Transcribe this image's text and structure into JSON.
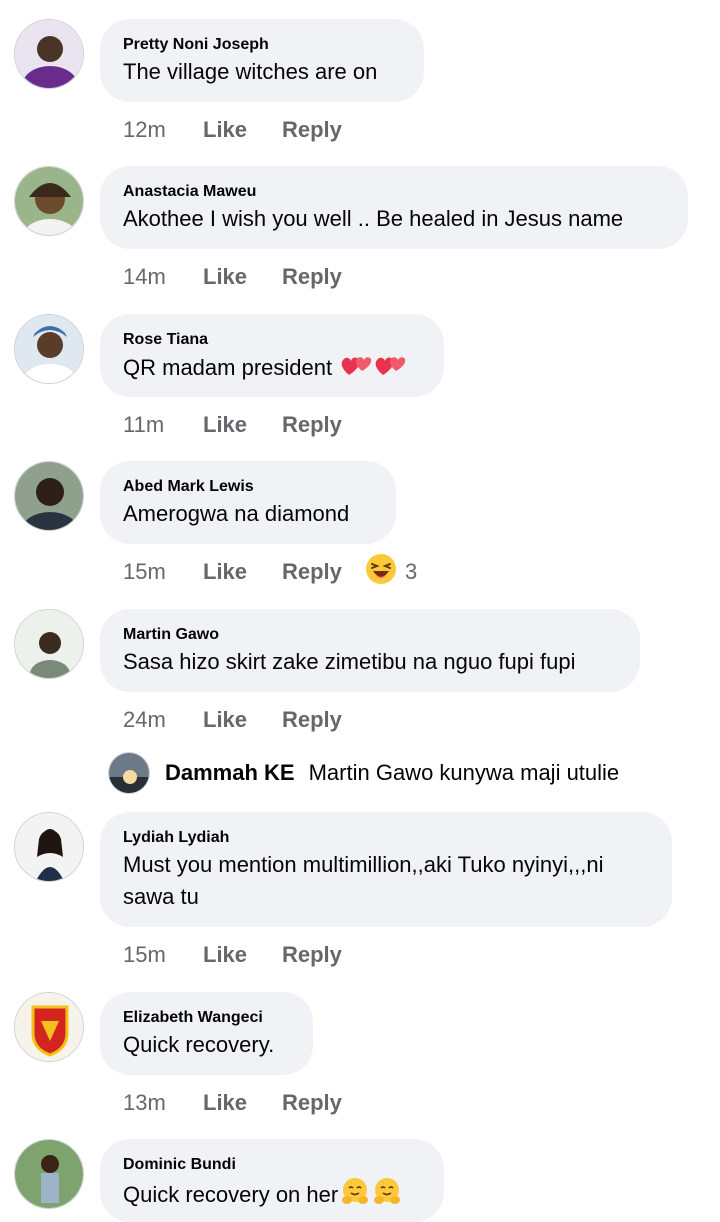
{
  "labels": {
    "like": "Like",
    "reply": "Reply"
  },
  "comments": [
    {
      "author": "Pretty Noni Joseph",
      "text": "The village witches are on",
      "time": "12m"
    },
    {
      "author": "Anastacia Maweu",
      "text": "Akothee I wish you well .. Be healed in Jesus name",
      "time": "14m"
    },
    {
      "author": "Rose Tiana",
      "text": "QR madam president",
      "time": "11m"
    },
    {
      "author": "Abed Mark Lewis",
      "text": "Amerogwa na diamond",
      "time": "15m",
      "reaction_count": "3"
    },
    {
      "author": "Martin Gawo",
      "text": "Sasa hizo skirt zake zimetibu na nguo fupi fupi",
      "time": "24m"
    },
    {
      "author": "Lydiah Lydiah",
      "text": "Must you mention multimillion,,aki Tuko nyinyi,,,ni sawa tu",
      "time": "15m"
    },
    {
      "author": "Elizabeth Wangeci",
      "text": "Quick recovery.",
      "time": "13m"
    },
    {
      "author": "Dominic Bundi",
      "text": "Quick recovery on her",
      "time": ""
    }
  ],
  "reply": {
    "author": "Dammah KE",
    "text": "Martin Gawo kunywa maji utulie"
  },
  "icons": {
    "two_hearts": "two-hearts-emoji",
    "laughing": "laughing-emoji",
    "hugging": "hugging-emoji"
  }
}
